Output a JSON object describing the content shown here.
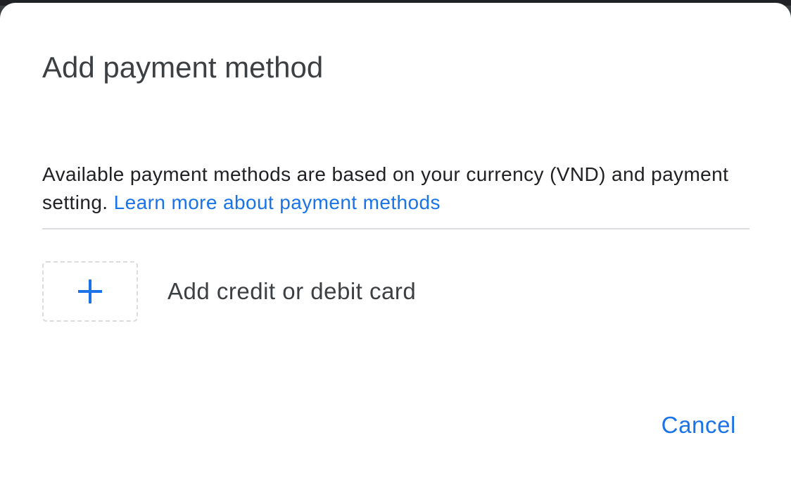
{
  "dialog": {
    "title": "Add payment method",
    "info_text": "Available payment methods are based on your currency (VND) and payment setting.",
    "learn_more_link": "Learn more about payment methods",
    "add_card": {
      "icon": "plus-icon",
      "label": "Add credit or debit card"
    },
    "cancel_label": "Cancel"
  },
  "colors": {
    "accent": "#1a73e8",
    "title_text": "#3c4043",
    "body_text": "#202124",
    "divider": "#dadce0",
    "dialog_background": "#ffffff"
  }
}
